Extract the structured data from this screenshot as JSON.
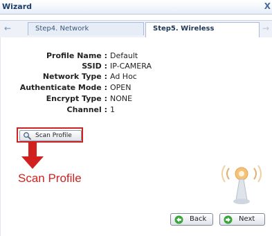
{
  "window": {
    "title": "Wizard",
    "close_label": "X"
  },
  "tabs": [
    {
      "label": "Step4. Network",
      "active": false
    },
    {
      "label": "Step5. Wireless",
      "active": true
    }
  ],
  "profile": [
    {
      "label": "Profile Name :",
      "value": "Default"
    },
    {
      "label": "SSID :",
      "value": "IP-CAMERA"
    },
    {
      "label": "Network Type :",
      "value": "Ad Hoc"
    },
    {
      "label": "Authenticate Mode :",
      "value": "OPEN"
    },
    {
      "label": "Encrypt Type :",
      "value": "NONE"
    },
    {
      "label": "Channel :",
      "value": "1"
    }
  ],
  "scan_button": {
    "label": "Scan Profile",
    "icon": "magnifier-icon"
  },
  "annotation": {
    "text": "Scan Profile",
    "color": "#d02020"
  },
  "footer": {
    "back_label": "Back",
    "next_label": "Next"
  },
  "colors": {
    "accent": "#3aa53a",
    "highlight": "#d02020",
    "title": "#1e3f6e"
  }
}
